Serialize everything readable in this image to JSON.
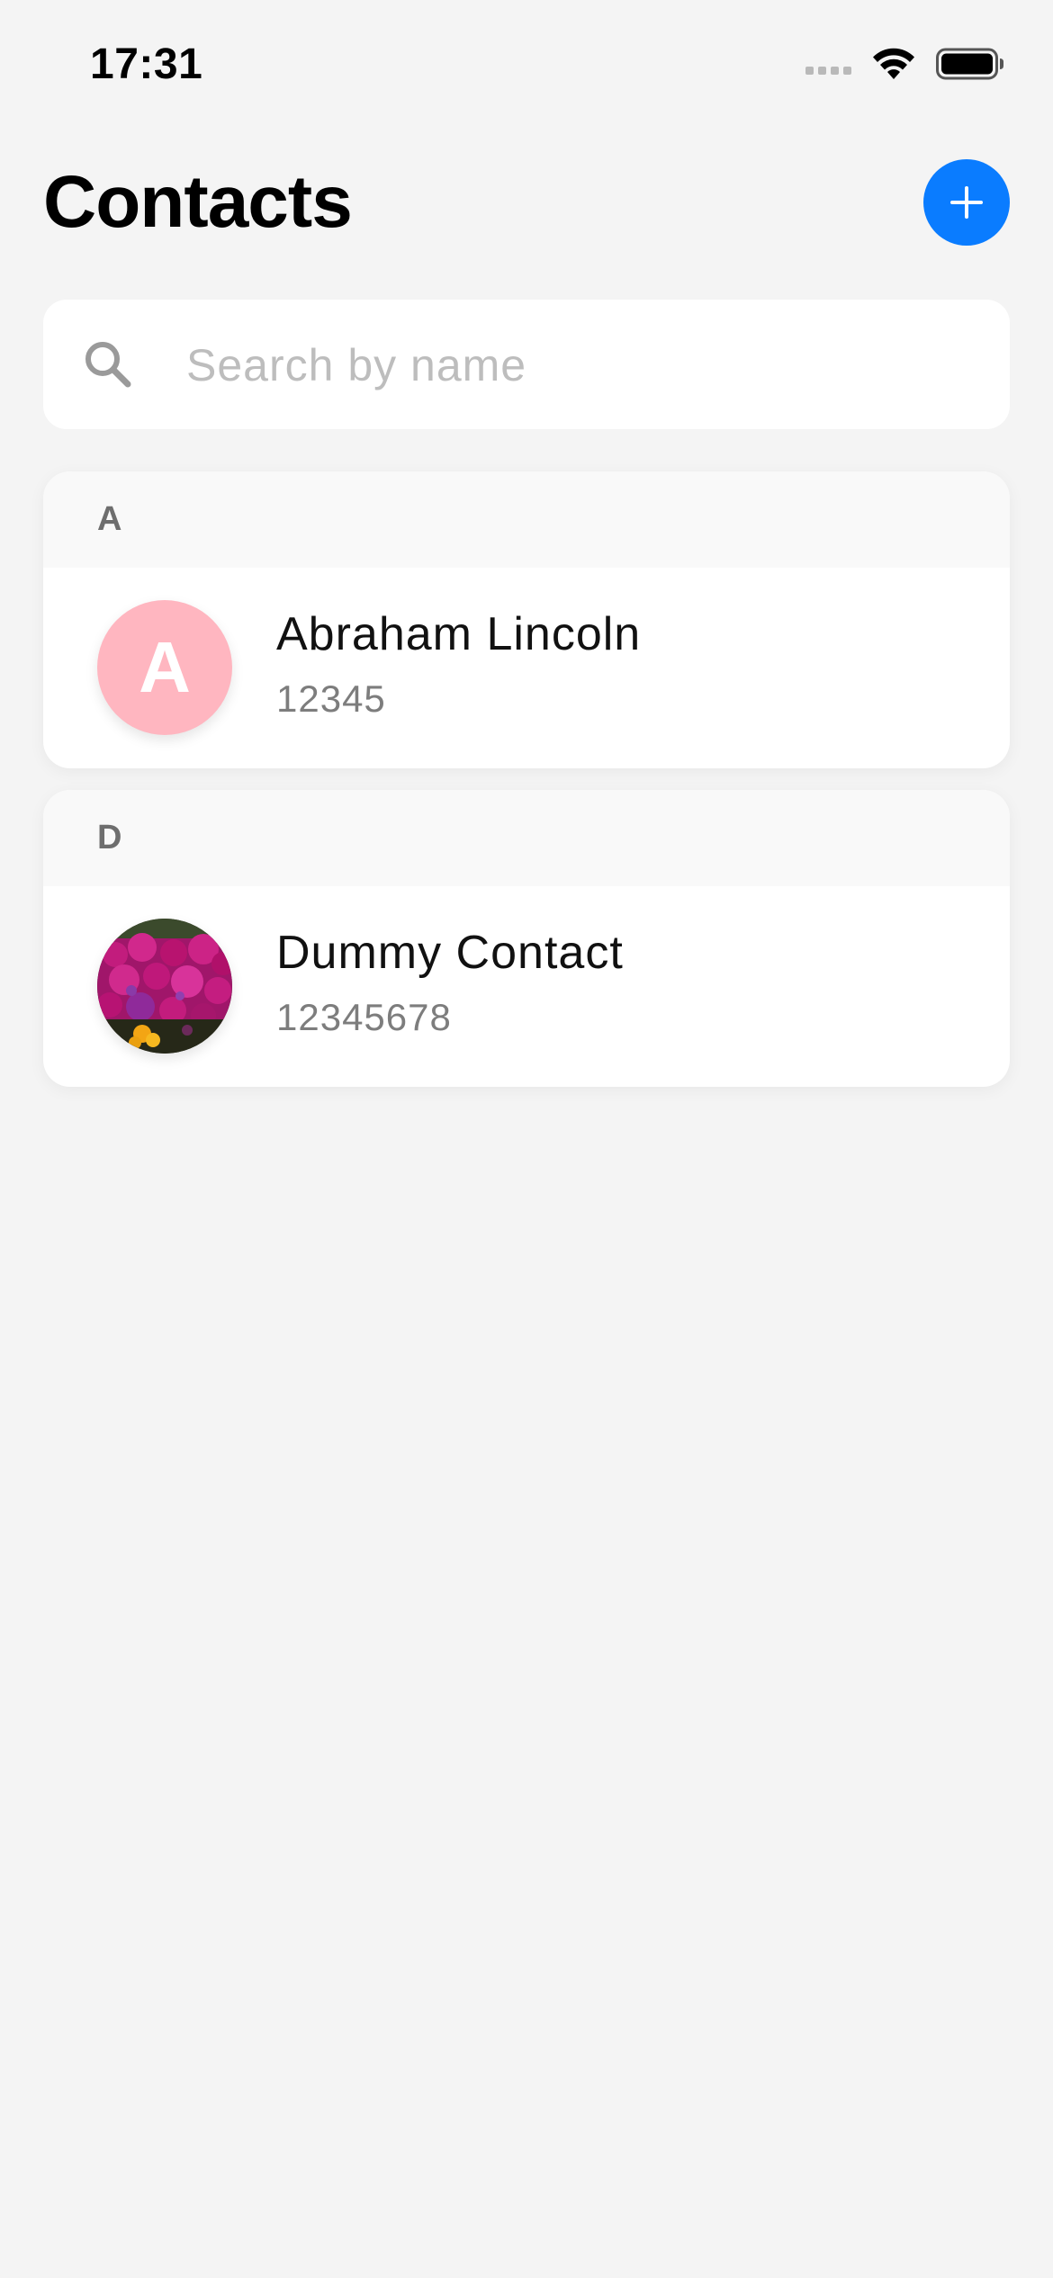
{
  "status_bar": {
    "time": "17:31",
    "icons": [
      "signal-icon",
      "wifi-icon",
      "battery-icon"
    ]
  },
  "header": {
    "title": "Contacts",
    "add_button_icon": "plus-icon"
  },
  "search": {
    "placeholder": "Search by name",
    "value": "",
    "icon": "search-icon"
  },
  "colors": {
    "accent": "#0a7cff",
    "background": "#f4f4f4",
    "avatar_initial_bg": "#ffb6c0"
  },
  "sections": [
    {
      "letter": "A",
      "contacts": [
        {
          "name": "Abraham Lincoln",
          "phone": "12345",
          "avatar_initial": "A"
        }
      ]
    },
    {
      "letter": "D",
      "contacts": [
        {
          "name": "Dummy Contact",
          "phone": "12345678",
          "avatar_image": "flowers-photo"
        }
      ]
    }
  ]
}
